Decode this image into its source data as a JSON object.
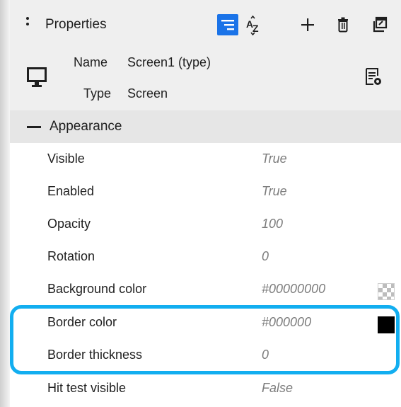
{
  "panel": {
    "title": "Properties",
    "toolbar": {
      "buttons": [
        {
          "icon": "sort-by-category-icon",
          "active": true
        },
        {
          "icon": "sort-alphabetical-icon",
          "label": "AZ"
        },
        {
          "icon": "add-icon"
        },
        {
          "icon": "delete-icon"
        },
        {
          "icon": "new-window-icon"
        }
      ]
    }
  },
  "element": {
    "name_label": "Name",
    "name_value": "Screen1 (type)",
    "type_label": "Type",
    "type_value": "Screen",
    "icon": "monitor-icon",
    "settings_icon": "document-settings-icon"
  },
  "section": {
    "title": "Appearance",
    "expanded": true
  },
  "properties": [
    {
      "label": "Visible",
      "value": "True"
    },
    {
      "label": "Enabled",
      "value": "True"
    },
    {
      "label": "Opacity",
      "value": "100"
    },
    {
      "label": "Rotation",
      "value": "0"
    },
    {
      "label": "Background color",
      "value": "#00000000",
      "swatch": "transparent"
    },
    {
      "label": "Border color",
      "value": "#000000",
      "swatch": "#000000"
    },
    {
      "label": "Border thickness",
      "value": "0"
    },
    {
      "label": "Hit test visible",
      "value": "False"
    }
  ],
  "highlight": {
    "color": "#12aef0",
    "rows": [
      "Border color",
      "Border thickness"
    ]
  },
  "colors": {
    "accent": "#1a73e8",
    "header_bg": "#efefef",
    "section_bg": "#e6e6e6",
    "value_text": "#7c7c7c"
  }
}
